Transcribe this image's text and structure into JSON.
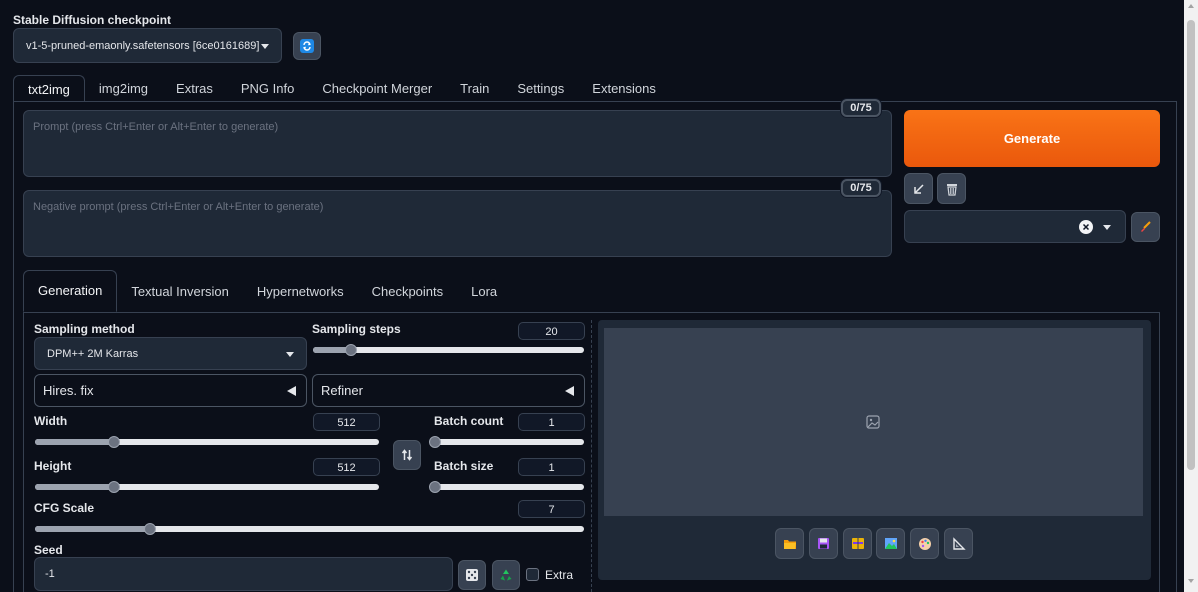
{
  "checkpoint": {
    "label": "Stable Diffusion checkpoint",
    "value": "v1-5-pruned-emaonly.safetensors [6ce0161689]"
  },
  "main_tabs": [
    {
      "label": "txt2img",
      "active": true
    },
    {
      "label": "img2img"
    },
    {
      "label": "Extras"
    },
    {
      "label": "PNG Info"
    },
    {
      "label": "Checkpoint Merger"
    },
    {
      "label": "Train"
    },
    {
      "label": "Settings"
    },
    {
      "label": "Extensions"
    }
  ],
  "prompt": {
    "placeholder": "Prompt (press Ctrl+Enter or Alt+Enter to generate)",
    "token_count": "0/75"
  },
  "negative_prompt": {
    "placeholder": "Negative prompt (press Ctrl+Enter or Alt+Enter to generate)",
    "token_count": "0/75"
  },
  "generate_label": "Generate",
  "sub_tabs": [
    {
      "label": "Generation",
      "active": true
    },
    {
      "label": "Textual Inversion"
    },
    {
      "label": "Hypernetworks"
    },
    {
      "label": "Checkpoints"
    },
    {
      "label": "Lora"
    }
  ],
  "sampling_method": {
    "label": "Sampling method",
    "value": "DPM++ 2M Karras"
  },
  "sampling_steps": {
    "label": "Sampling steps",
    "value": "20",
    "fraction": 0.14
  },
  "hires_fix": {
    "label": "Hires. fix"
  },
  "refiner": {
    "label": "Refiner"
  },
  "width": {
    "label": "Width",
    "value": "512",
    "fraction": 0.23
  },
  "height": {
    "label": "Height",
    "value": "512",
    "fraction": 0.23
  },
  "batch_count": {
    "label": "Batch count",
    "value": "1",
    "fraction": 0.0
  },
  "batch_size": {
    "label": "Batch size",
    "value": "1",
    "fraction": 0.0
  },
  "cfg_scale": {
    "label": "CFG Scale",
    "value": "7",
    "fraction": 0.21
  },
  "seed": {
    "label": "Seed",
    "value": "-1",
    "extra_label": "Extra"
  },
  "colors": {
    "accent": "#f97316",
    "background": "#0b0f19",
    "panel": "#1f2937"
  },
  "icons": {
    "refresh": "refresh-icon",
    "paste": "arrow-down-left-icon",
    "trash": "trash-icon",
    "clear": "close-circle-icon",
    "style_edit": "brush-icon",
    "swap": "swap-icon",
    "dice": "dice-icon",
    "recycle": "recycle-icon",
    "image_placeholder": "image-icon",
    "gallery": [
      "folder-icon",
      "save-icon",
      "zip-icon",
      "send-to-img2img-icon",
      "send-to-inpaint-icon",
      "send-to-extras-icon"
    ]
  }
}
